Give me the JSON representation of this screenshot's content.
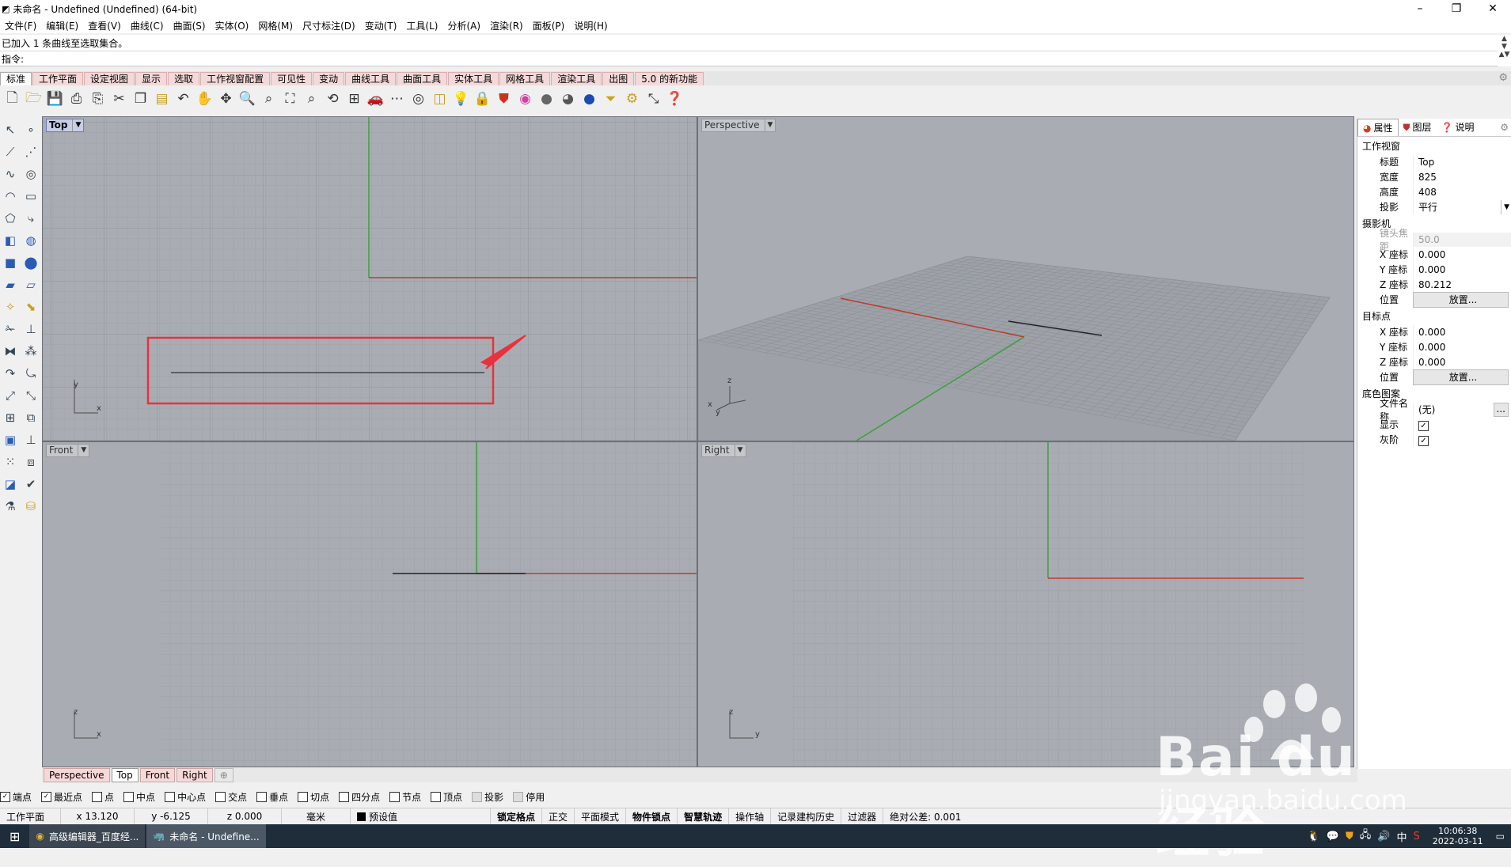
{
  "window": {
    "title": "未命名 - Undefined (Undefined) (64-bit)",
    "controls": [
      "–",
      "❐",
      "✕"
    ]
  },
  "menu": [
    "文件(F)",
    "编辑(E)",
    "查看(V)",
    "曲线(C)",
    "曲面(S)",
    "实体(O)",
    "网格(M)",
    "尺寸标注(D)",
    "变动(T)",
    "工具(L)",
    "分析(A)",
    "渲染(R)",
    "面板(P)",
    "说明(H)"
  ],
  "command": {
    "history": "已加入 1 条曲线至选取集合。",
    "prompt": "指令:"
  },
  "toolbar_tabs": [
    "标准",
    "工作平面",
    "设定视图",
    "显示",
    "选取",
    "工作视窗配置",
    "可见性",
    "变动",
    "曲线工具",
    "曲面工具",
    "实体工具",
    "网格工具",
    "渲染工具",
    "出图",
    "5.0 的新功能"
  ],
  "toolbar_icons": [
    "new-icon",
    "open-icon",
    "save-icon",
    "print-icon",
    "import-icon",
    "cut-icon",
    "copy-icon",
    "paste-icon",
    "undo-icon",
    "pan-icon",
    "rotate-view-icon",
    "zoom-icon",
    "zoom-window-icon",
    "zoom-extents-icon",
    "zoom-selected-icon",
    "rotate-icon",
    "four-view-icon",
    "car-icon",
    "mesh-icon",
    "circle-icon",
    "snap-icon",
    "light-icon",
    "lock-icon",
    "shield-icon",
    "color-wheel-icon",
    "sphere-grey-icon",
    "sphere-shaded-icon",
    "sphere-blue-icon",
    "filter-icon",
    "settings-icon",
    "transform-icon",
    "help-icon"
  ],
  "viewports": {
    "top": {
      "label": "Top"
    },
    "perspective": {
      "label": "Perspective"
    },
    "front": {
      "label": "Front"
    },
    "right": {
      "label": "Right"
    }
  },
  "axis_letters": {
    "x": "x",
    "y": "y",
    "z": "z"
  },
  "viewport_tabs": [
    "Perspective",
    "Top",
    "Front",
    "Right"
  ],
  "viewport_tabs_add": "⊕",
  "osnaps": [
    {
      "label": "端点",
      "checked": true
    },
    {
      "label": "最近点",
      "checked": true
    },
    {
      "label": "点",
      "checked": false
    },
    {
      "label": "中点",
      "checked": false
    },
    {
      "label": "中心点",
      "checked": false
    },
    {
      "label": "交点",
      "checked": false
    },
    {
      "label": "垂点",
      "checked": false
    },
    {
      "label": "切点",
      "checked": false
    },
    {
      "label": "四分点",
      "checked": false
    },
    {
      "label": "节点",
      "checked": false
    },
    {
      "label": "顶点",
      "checked": false
    },
    {
      "label": "投影",
      "checked": false,
      "disabled": true
    },
    {
      "label": "停用",
      "checked": false,
      "disabled": true
    }
  ],
  "status": {
    "cplane": "工作平面",
    "x": "x 13.120",
    "y": "y -6.125",
    "z": "z 0.000",
    "unit": "毫米",
    "layer": "预设值",
    "grid_snap": "锁定格点",
    "ortho": "正交",
    "planar": "平面模式",
    "osnap": "物件锁点",
    "smarttrack": "智慧轨迹",
    "gumball": "操作轴",
    "history": "记录建构历史",
    "filter": "过滤器",
    "tolerance": "绝对公差: 0.001"
  },
  "panel": {
    "tabs": [
      "属性",
      "图层",
      "说明"
    ],
    "viewport_section": "工作视窗",
    "title_label": "标题",
    "title_value": "Top",
    "width_label": "宽度",
    "width_value": "825",
    "height_label": "高度",
    "height_value": "408",
    "projection_label": "投影",
    "projection_value": "平行",
    "camera_section": "摄影机",
    "focal_label": "镜头焦距",
    "focal_value": "50.0",
    "cam_x_label": "X 座标",
    "cam_x": "0.000",
    "cam_y_label": "Y 座标",
    "cam_y": "0.000",
    "cam_z_label": "Z 座标",
    "cam_z": "80.212",
    "position_label": "位置",
    "place_button": "放置...",
    "target_section": "目标点",
    "tgt_x_label": "X 座标",
    "tgt_x": "0.000",
    "tgt_y_label": "Y 座标",
    "tgt_y": "0.000",
    "tgt_z_label": "Z 座标",
    "tgt_z": "0.000",
    "target_position_label": "位置",
    "target_place_button": "放置...",
    "wallpaper_section": "底色图案",
    "filename_label": "文件名称",
    "filename_value": "(无)",
    "show_label": "显示",
    "show_checked": true,
    "grayscale_label": "灰阶",
    "grayscale_checked": true
  },
  "taskbar": {
    "app1": "高级编辑器_百度经...",
    "app2": "未命名 - Undefine...",
    "ime": "中",
    "time": "10:06:38",
    "date": "2022-03-11"
  },
  "watermark": {
    "brand": "Bai du 经验",
    "url": "jingyan.baidu.com"
  },
  "colors": {
    "viewport_bg": "#a9adb3",
    "grid_line": "#9ea2a8",
    "grid_major": "#8f949b",
    "x_axis": "#c0392b",
    "y_axis": "#3aa13a",
    "highlight": "#e8323c"
  }
}
